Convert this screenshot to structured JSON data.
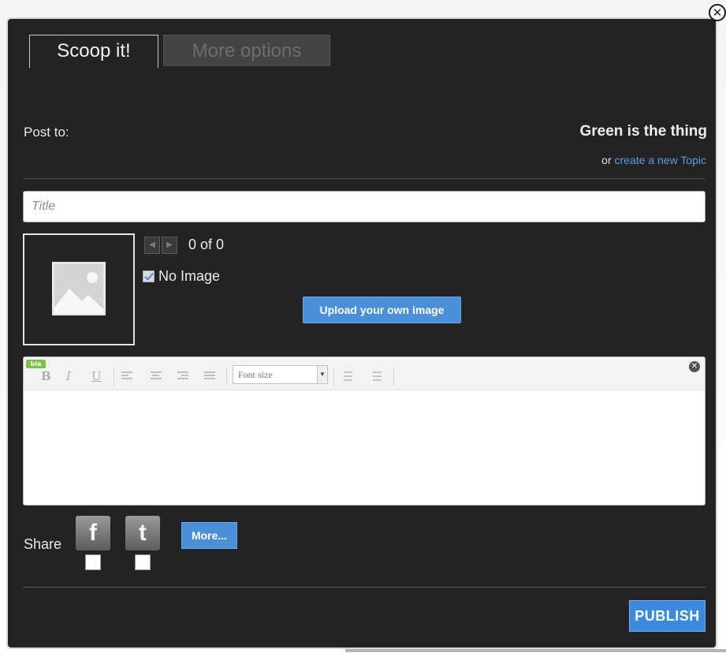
{
  "dialog": {
    "close_icon": "close-x-icon",
    "tabs": [
      {
        "label": "Scoop it!",
        "active": true
      },
      {
        "label": "More options",
        "active": false
      }
    ]
  },
  "post_to": {
    "label": "Post to:",
    "topic_name": "Green is the thing",
    "or_text": "or",
    "create_link": "create a new Topic"
  },
  "title_field": {
    "placeholder": "Title",
    "value": ""
  },
  "image": {
    "placeholder_icon": "image-placeholder-icon",
    "count_text": "0 of 0",
    "no_image_label": "No Image",
    "no_image_checked": true,
    "upload_label": "Upload your own image"
  },
  "editor": {
    "badge": "bia",
    "bold": "B",
    "italic": "I",
    "underline": "U",
    "font_size_label": "Font size",
    "content": ""
  },
  "share": {
    "label": "Share",
    "facebook_glyph": "f",
    "twitter_glyph": "t",
    "more_label": "More..."
  },
  "actions": {
    "publish_label": "PUBLISH"
  },
  "colors": {
    "dialog_bg": "#232323",
    "accent_blue": "#4a90d9",
    "link_blue": "#5a9be6",
    "badge_green": "#7cc242"
  }
}
